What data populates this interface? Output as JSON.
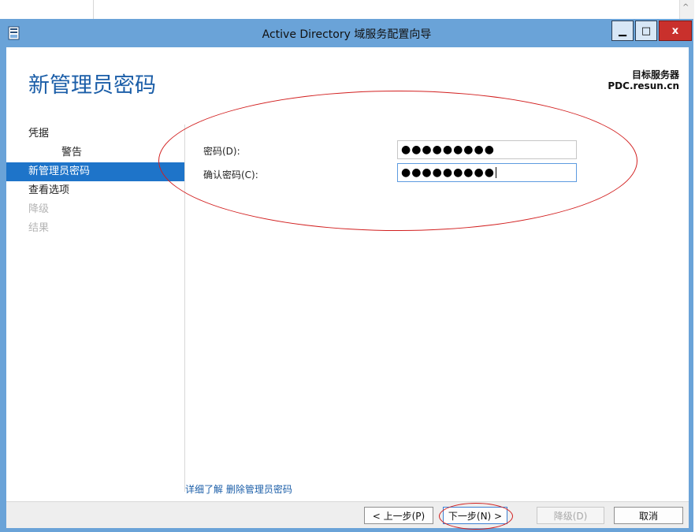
{
  "window": {
    "title": "Active Directory 域服务配置向导",
    "min_glyph": "▁",
    "max_glyph": "□",
    "close_glyph": "x"
  },
  "page": {
    "title": "新管理员密码",
    "target_label": "目标服务器",
    "target_server": "PDC.resun.cn"
  },
  "nav": {
    "items": [
      {
        "label": "凭据",
        "state": "normal"
      },
      {
        "label": "警告",
        "state": "sub"
      },
      {
        "label": "新管理员密码",
        "state": "active"
      },
      {
        "label": "查看选项",
        "state": "normal"
      },
      {
        "label": "降级",
        "state": "disabled"
      },
      {
        "label": "结果",
        "state": "disabled"
      }
    ]
  },
  "form": {
    "password_label": "密码(D):",
    "password_value": "●●●●●●●●●",
    "confirm_label": "确认密码(C):",
    "confirm_value": "●●●●●●●●●"
  },
  "more_link": "详细了解 删除管理员密码",
  "footer": {
    "prev": "< 上一步(P)",
    "next": "下一步(N) >",
    "demote": "降级(D)",
    "cancel": "取消"
  },
  "colors": {
    "accent": "#1e74c9",
    "title_bar": "#6aa3d8",
    "annotation": "#d21f1f"
  }
}
